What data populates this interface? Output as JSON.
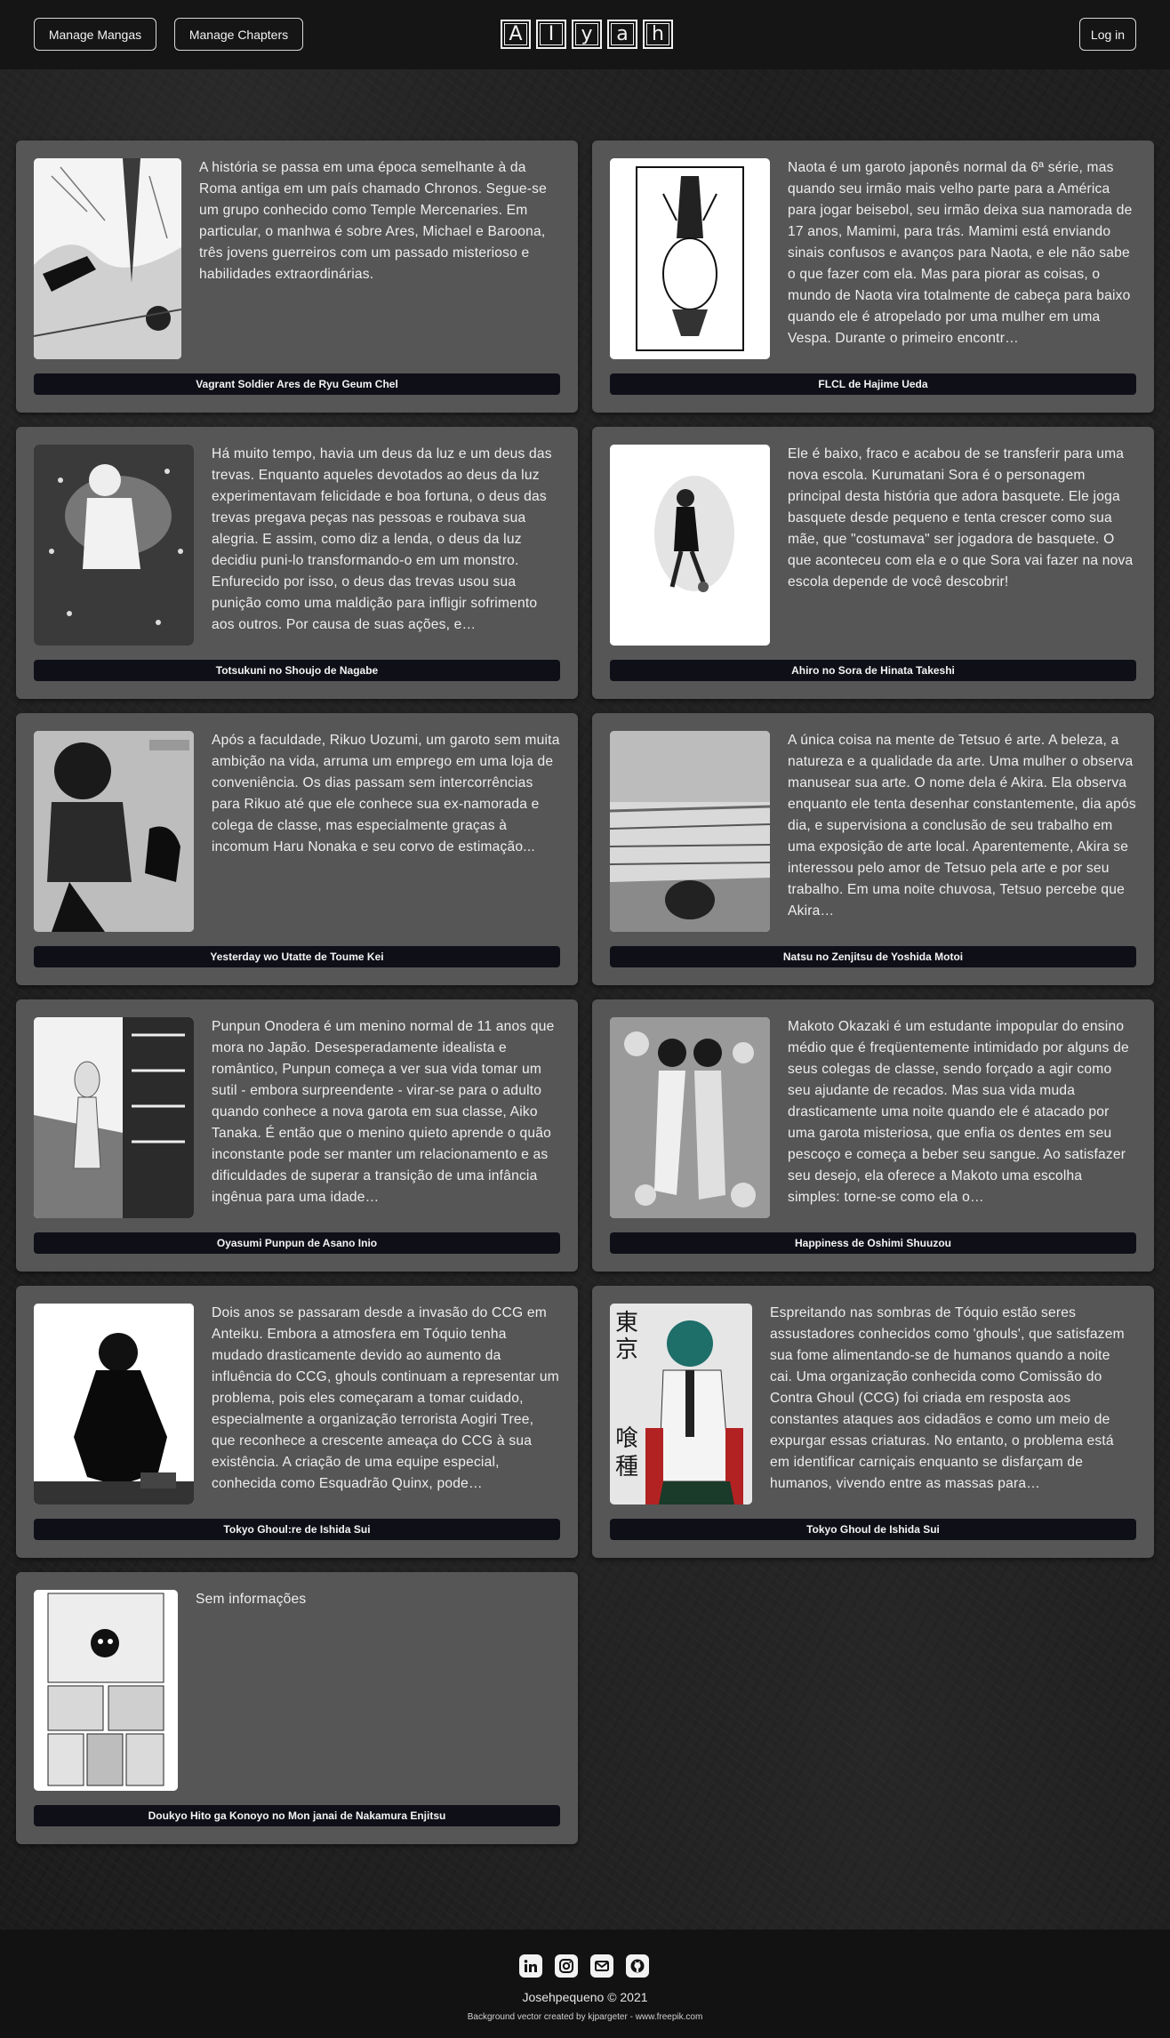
{
  "header": {
    "manage_mangas": "Manage Mangas",
    "manage_chapters": "Manage Chapters",
    "logo_letters": [
      "A",
      "I",
      "y",
      "a",
      "h"
    ],
    "login": "Log in"
  },
  "cards": [
    {
      "title": "Vagrant Soldier Ares de Ryu Geum Chel",
      "description": "A história se passa em uma época semelhante à da Roma antiga em um país chamado Chronos. Segue-se um grupo conhecido como Temple Mercenaries. Em particular, o manhwa é sobre Ares, Michael e Baroona, três jovens guerreiros com um passado misterioso e habilidades extraordinárias."
    },
    {
      "title": "FLCL de Hajime Ueda",
      "description": "Naota é um garoto japonês normal da 6ª série, mas quando seu irmão mais velho parte para a América para jogar beisebol, seu irmão deixa sua namorada de 17 anos, Mamimi, para trás. Mamimi está enviando sinais confusos e avanços para Naota, e ele não sabe o que fazer com ela. Mas para piorar as coisas, o mundo de Naota vira totalmente de cabeça para baixo quando ele é atropelado por uma mulher em uma Vespa. Durante o primeiro encontr…"
    },
    {
      "title": "Totsukuni no Shoujo de Nagabe",
      "description": "Há muito tempo, havia um deus da luz e um deus das trevas. Enquanto aqueles devotados ao deus da luz experimentavam felicidade e boa fortuna, o deus das trevas pregava peças nas pessoas e roubava sua alegria. E assim, como diz a lenda, o deus da luz decidiu puni-lo transformando-o em um monstro. Enfurecido por isso, o deus das trevas usou sua punição como uma maldição para infligir sofrimento aos outros. Por causa de suas ações, e…"
    },
    {
      "title": "Ahiro no Sora de Hinata Takeshi",
      "description": "Ele é baixo, fraco e acabou de se transferir para uma nova escola. Kurumatani Sora é o personagem principal desta história que adora basquete. Ele joga basquete desde pequeno e tenta crescer como sua mãe, que \"costumava\" ser jogadora de basquete. O que aconteceu com ela e o que Sora vai fazer na nova escola depende de você descobrir!"
    },
    {
      "title": "Yesterday wo Utatte de Toume Kei",
      "description": "Após a faculdade, Rikuo Uozumi, um garoto sem muita ambição na vida, arruma um emprego em uma loja de conveniência. Os dias passam sem intercorrências para Rikuo até que ele conhece sua ex-namorada e colega de classe, mas especialmente graças à incomum Haru Nonaka e seu corvo de estimação..."
    },
    {
      "title": "Natsu no Zenjitsu de Yoshida Motoi",
      "description": "A única coisa na mente de Tetsuo é arte. A beleza, a natureza e a qualidade da arte. Uma mulher o observa manusear sua arte. O nome dela é Akira. Ela observa enquanto ele tenta desenhar constantemente, dia após dia, e supervisiona a conclusão de seu trabalho em uma exposição de arte local. Aparentemente, Akira se interessou pelo amor de Tetsuo pela arte e por seu trabalho. Em uma noite chuvosa, Tetsuo percebe que Akira…"
    },
    {
      "title": "Oyasumi Punpun de Asano Inio",
      "description": "Punpun Onodera é um menino normal de 11 anos que mora no Japão. Desesperadamente idealista e romântico, Punpun começa a ver sua vida tomar um sutil - embora surpreendente - virar-se para o adulto quando conhece a nova garota em sua classe, Aiko Tanaka. É então que o menino quieto aprende o quão inconstante pode ser manter um relacionamento e as dificuldades de superar a transição de uma infância ingênua para uma idade…"
    },
    {
      "title": "Happiness de Oshimi Shuuzou",
      "description": "Makoto Okazaki é um estudante impopular do ensino médio que é freqüentemente intimidado por alguns de seus colegas de classe, sendo forçado a agir como seu ajudante de recados. Mas sua vida muda drasticamente uma noite quando ele é atacado por uma garota misteriosa, que enfia os dentes em seu pescoço e começa a beber seu sangue. Ao satisfazer seu desejo, ela oferece a Makoto uma escolha simples: torne-se como ela o…"
    },
    {
      "title": "Tokyo Ghoul:re de Ishida Sui",
      "description": "Dois anos se passaram desde a invasão do CCG em Anteiku. Embora a atmosfera em Tóquio tenha mudado drasticamente devido ao aumento da influência do CCG, ghouls continuam a representar um problema, pois eles começaram a tomar cuidado, especialmente a organização terrorista Aogiri Tree, que reconhece a crescente ameaça do CCG à sua existência. A criação de uma equipe especial, conhecida como Esquadrão Quinx, pode…"
    },
    {
      "title": "Tokyo Ghoul de Ishida Sui",
      "description": "Espreitando nas sombras de Tóquio estão seres assustadores conhecidos como 'ghouls', que satisfazem sua fome alimentando-se de humanos quando a noite cai. Uma organização conhecida como Comissão do Contra Ghoul (CCG) foi criada em resposta aos constantes ataques aos cidadãos e como um meio de expurgar essas criaturas. No entanto, o problema está em identificar carniçais enquanto se disfarçam de humanos, vivendo entre as massas para…"
    },
    {
      "title": "Doukyo Hito ga Konoyo no Mon janai de Nakamura Enjitsu",
      "description": "Sem informações"
    }
  ],
  "footer": {
    "social_icons": [
      "linkedin-icon",
      "instagram-icon",
      "mail-icon",
      "github-icon"
    ],
    "copyright": "Josehpequeno © 2021",
    "credit": "Background vector created by kjpargeter - www.freepik.com"
  },
  "colors": {
    "card_bg": "#565656",
    "title_bar_bg": "#0f0f18",
    "header_bg": "#151515",
    "footer_bg": "#121212"
  }
}
